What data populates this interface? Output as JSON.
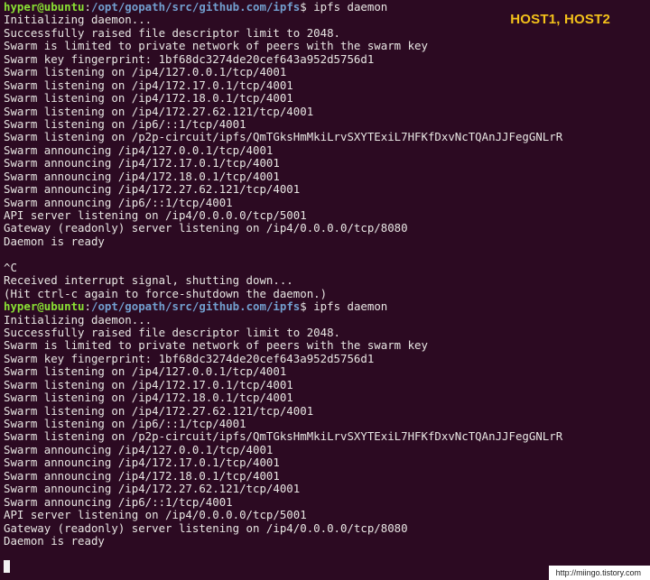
{
  "overlay": {
    "label": "HOST1, HOST2"
  },
  "watermark": "http://miingo.tistory.com",
  "colors": {
    "background": "#2c0a22",
    "user": "#8ae234",
    "path": "#729fcf",
    "text": "#e8e6e3",
    "overlay": "#f4c21a"
  },
  "lines": [
    {
      "type": "prompt",
      "user": "hyper@ubuntu",
      "colon": ":",
      "path": "/opt/gopath/src/github.com/ipfs",
      "dollar": "$",
      "cmd": " ipfs daemon"
    },
    {
      "type": "text",
      "text": "Initializing daemon..."
    },
    {
      "type": "text",
      "text": "Successfully raised file descriptor limit to 2048."
    },
    {
      "type": "text",
      "text": "Swarm is limited to private network of peers with the swarm key"
    },
    {
      "type": "text",
      "text": "Swarm key fingerprint: 1bf68dc3274de20cef643a952d5756d1"
    },
    {
      "type": "text",
      "text": "Swarm listening on /ip4/127.0.0.1/tcp/4001"
    },
    {
      "type": "text",
      "text": "Swarm listening on /ip4/172.17.0.1/tcp/4001"
    },
    {
      "type": "text",
      "text": "Swarm listening on /ip4/172.18.0.1/tcp/4001"
    },
    {
      "type": "text",
      "text": "Swarm listening on /ip4/172.27.62.121/tcp/4001"
    },
    {
      "type": "text",
      "text": "Swarm listening on /ip6/::1/tcp/4001"
    },
    {
      "type": "text",
      "text": "Swarm listening on /p2p-circuit/ipfs/QmTGksHmMkiLrvSXYTExiL7HFKfDxvNcTQAnJJFegGNLrR"
    },
    {
      "type": "text",
      "text": "Swarm announcing /ip4/127.0.0.1/tcp/4001"
    },
    {
      "type": "text",
      "text": "Swarm announcing /ip4/172.17.0.1/tcp/4001"
    },
    {
      "type": "text",
      "text": "Swarm announcing /ip4/172.18.0.1/tcp/4001"
    },
    {
      "type": "text",
      "text": "Swarm announcing /ip4/172.27.62.121/tcp/4001"
    },
    {
      "type": "text",
      "text": "Swarm announcing /ip6/::1/tcp/4001"
    },
    {
      "type": "text",
      "text": "API server listening on /ip4/0.0.0.0/tcp/5001"
    },
    {
      "type": "text",
      "text": "Gateway (readonly) server listening on /ip4/0.0.0.0/tcp/8080"
    },
    {
      "type": "text",
      "text": "Daemon is ready"
    },
    {
      "type": "text",
      "text": ""
    },
    {
      "type": "text",
      "text": "^C"
    },
    {
      "type": "text",
      "text": "Received interrupt signal, shutting down..."
    },
    {
      "type": "text",
      "text": "(Hit ctrl-c again to force-shutdown the daemon.)"
    },
    {
      "type": "prompt",
      "user": "hyper@ubuntu",
      "colon": ":",
      "path": "/opt/gopath/src/github.com/ipfs",
      "dollar": "$",
      "cmd": " ipfs daemon"
    },
    {
      "type": "text",
      "text": "Initializing daemon..."
    },
    {
      "type": "text",
      "text": "Successfully raised file descriptor limit to 2048."
    },
    {
      "type": "text",
      "text": "Swarm is limited to private network of peers with the swarm key"
    },
    {
      "type": "text",
      "text": "Swarm key fingerprint: 1bf68dc3274de20cef643a952d5756d1"
    },
    {
      "type": "text",
      "text": "Swarm listening on /ip4/127.0.0.1/tcp/4001"
    },
    {
      "type": "text",
      "text": "Swarm listening on /ip4/172.17.0.1/tcp/4001"
    },
    {
      "type": "text",
      "text": "Swarm listening on /ip4/172.18.0.1/tcp/4001"
    },
    {
      "type": "text",
      "text": "Swarm listening on /ip4/172.27.62.121/tcp/4001"
    },
    {
      "type": "text",
      "text": "Swarm listening on /ip6/::1/tcp/4001"
    },
    {
      "type": "text",
      "text": "Swarm listening on /p2p-circuit/ipfs/QmTGksHmMkiLrvSXYTExiL7HFKfDxvNcTQAnJJFegGNLrR"
    },
    {
      "type": "text",
      "text": "Swarm announcing /ip4/127.0.0.1/tcp/4001"
    },
    {
      "type": "text",
      "text": "Swarm announcing /ip4/172.17.0.1/tcp/4001"
    },
    {
      "type": "text",
      "text": "Swarm announcing /ip4/172.18.0.1/tcp/4001"
    },
    {
      "type": "text",
      "text": "Swarm announcing /ip4/172.27.62.121/tcp/4001"
    },
    {
      "type": "text",
      "text": "Swarm announcing /ip6/::1/tcp/4001"
    },
    {
      "type": "text",
      "text": "API server listening on /ip4/0.0.0.0/tcp/5001"
    },
    {
      "type": "text",
      "text": "Gateway (readonly) server listening on /ip4/0.0.0.0/tcp/8080"
    },
    {
      "type": "text",
      "text": "Daemon is ready"
    }
  ]
}
